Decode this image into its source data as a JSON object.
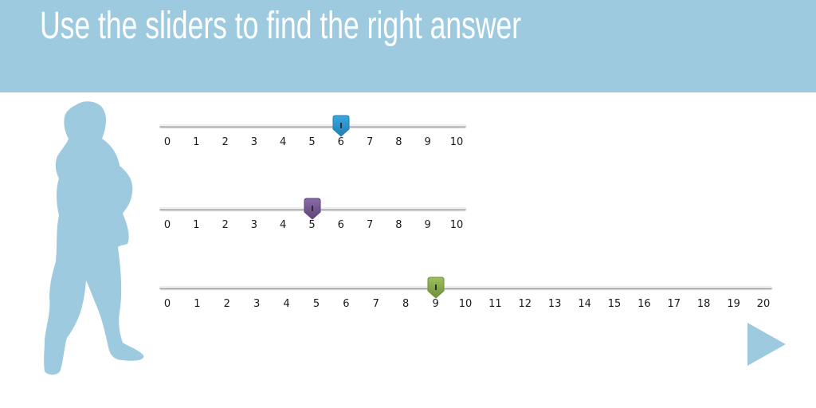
{
  "header": {
    "title": "Use the sliders to find the right answer",
    "banner_color": "#9dcadf"
  },
  "figure": {
    "icon": "child-silhouette-icon",
    "color": "#9dcadf"
  },
  "sliders": [
    {
      "id": "blue",
      "min": 0,
      "max": 10,
      "value": 6,
      "thumb_color": "#3aa7e0",
      "thumb_dark": "#1f7fb5",
      "ticks": [
        "0",
        "1",
        "2",
        "3",
        "4",
        "5",
        "6",
        "7",
        "8",
        "9",
        "10"
      ]
    },
    {
      "id": "purple",
      "min": 0,
      "max": 10,
      "value": 5,
      "thumb_color": "#8b6aaa",
      "thumb_dark": "#5e4478",
      "ticks": [
        "0",
        "1",
        "2",
        "3",
        "4",
        "5",
        "6",
        "7",
        "8",
        "9",
        "10"
      ]
    },
    {
      "id": "green",
      "min": 0,
      "max": 20,
      "value": 9,
      "thumb_color": "#9cc05e",
      "thumb_dark": "#6e8f37",
      "ticks": [
        "0",
        "1",
        "2",
        "3",
        "4",
        "5",
        "6",
        "7",
        "8",
        "9",
        "10",
        "11",
        "12",
        "13",
        "14",
        "15",
        "16",
        "17",
        "18",
        "19",
        "20"
      ]
    }
  ],
  "navigation": {
    "next_icon": "play-arrow-icon",
    "next_color": "#9dcadf"
  }
}
